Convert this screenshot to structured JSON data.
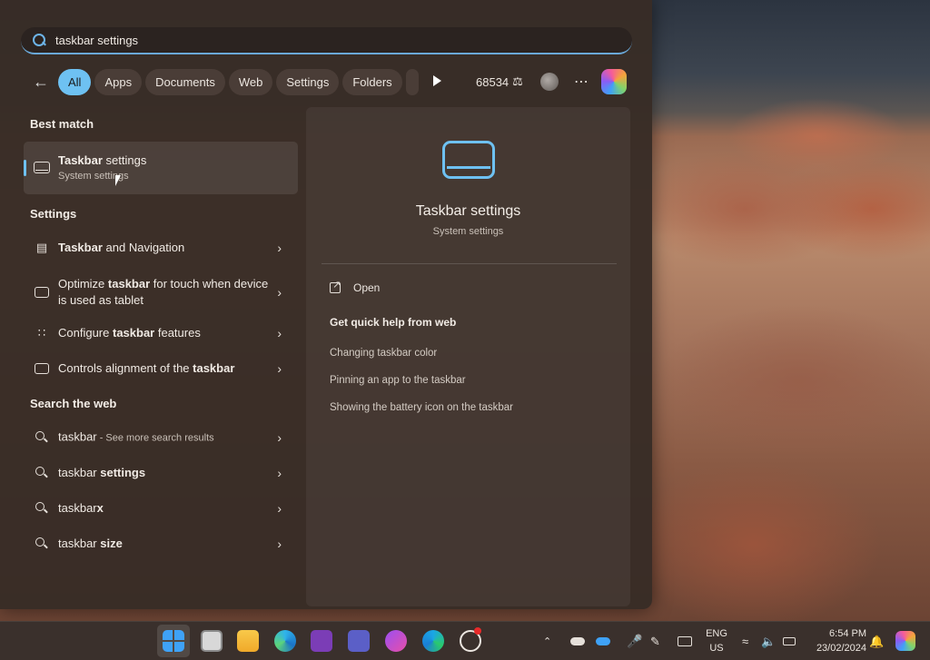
{
  "search": {
    "query": "taskbar settings"
  },
  "filters": {
    "back_icon": "arrow-left-icon",
    "pills": [
      "All",
      "Apps",
      "Documents",
      "Web",
      "Settings",
      "Folders"
    ],
    "points": "68534"
  },
  "best_match": {
    "heading": "Best match",
    "title_bold": "Taskbar",
    "title_rest": " settings",
    "subtitle": "System settings"
  },
  "settings": {
    "heading": "Settings",
    "items": [
      {
        "pre": "",
        "bold": "Taskbar",
        "post": " and Navigation"
      },
      {
        "pre": "Optimize ",
        "bold": "taskbar",
        "post": " for touch when device is used as tablet"
      },
      {
        "pre": "Configure ",
        "bold": "taskbar",
        "post": " features"
      },
      {
        "pre": "Controls alignment of the ",
        "bold": "taskbar",
        "post": ""
      }
    ]
  },
  "web": {
    "heading": "Search the web",
    "items": [
      {
        "pre": "taskbar",
        "bold": "",
        "post": "",
        "small": " - See more search results"
      },
      {
        "pre": "taskbar ",
        "bold": "settings",
        "post": "",
        "small": ""
      },
      {
        "pre": "taskbar",
        "bold": "x",
        "post": "",
        "small": ""
      },
      {
        "pre": "taskbar ",
        "bold": "size",
        "post": "",
        "small": ""
      }
    ]
  },
  "preview": {
    "title": "Taskbar settings",
    "subtitle": "System settings",
    "open_label": "Open",
    "help_heading": "Get quick help from web",
    "links": [
      "Changing taskbar color",
      "Pinning an app to the taskbar",
      "Showing the battery icon on the taskbar"
    ]
  },
  "taskbar": {
    "lang_line1": "ENG",
    "lang_line2": "US",
    "time": "6:54 PM",
    "date": "23/02/2024"
  },
  "colors": {
    "accent": "#6ec1f2",
    "panel": "#382c26"
  }
}
